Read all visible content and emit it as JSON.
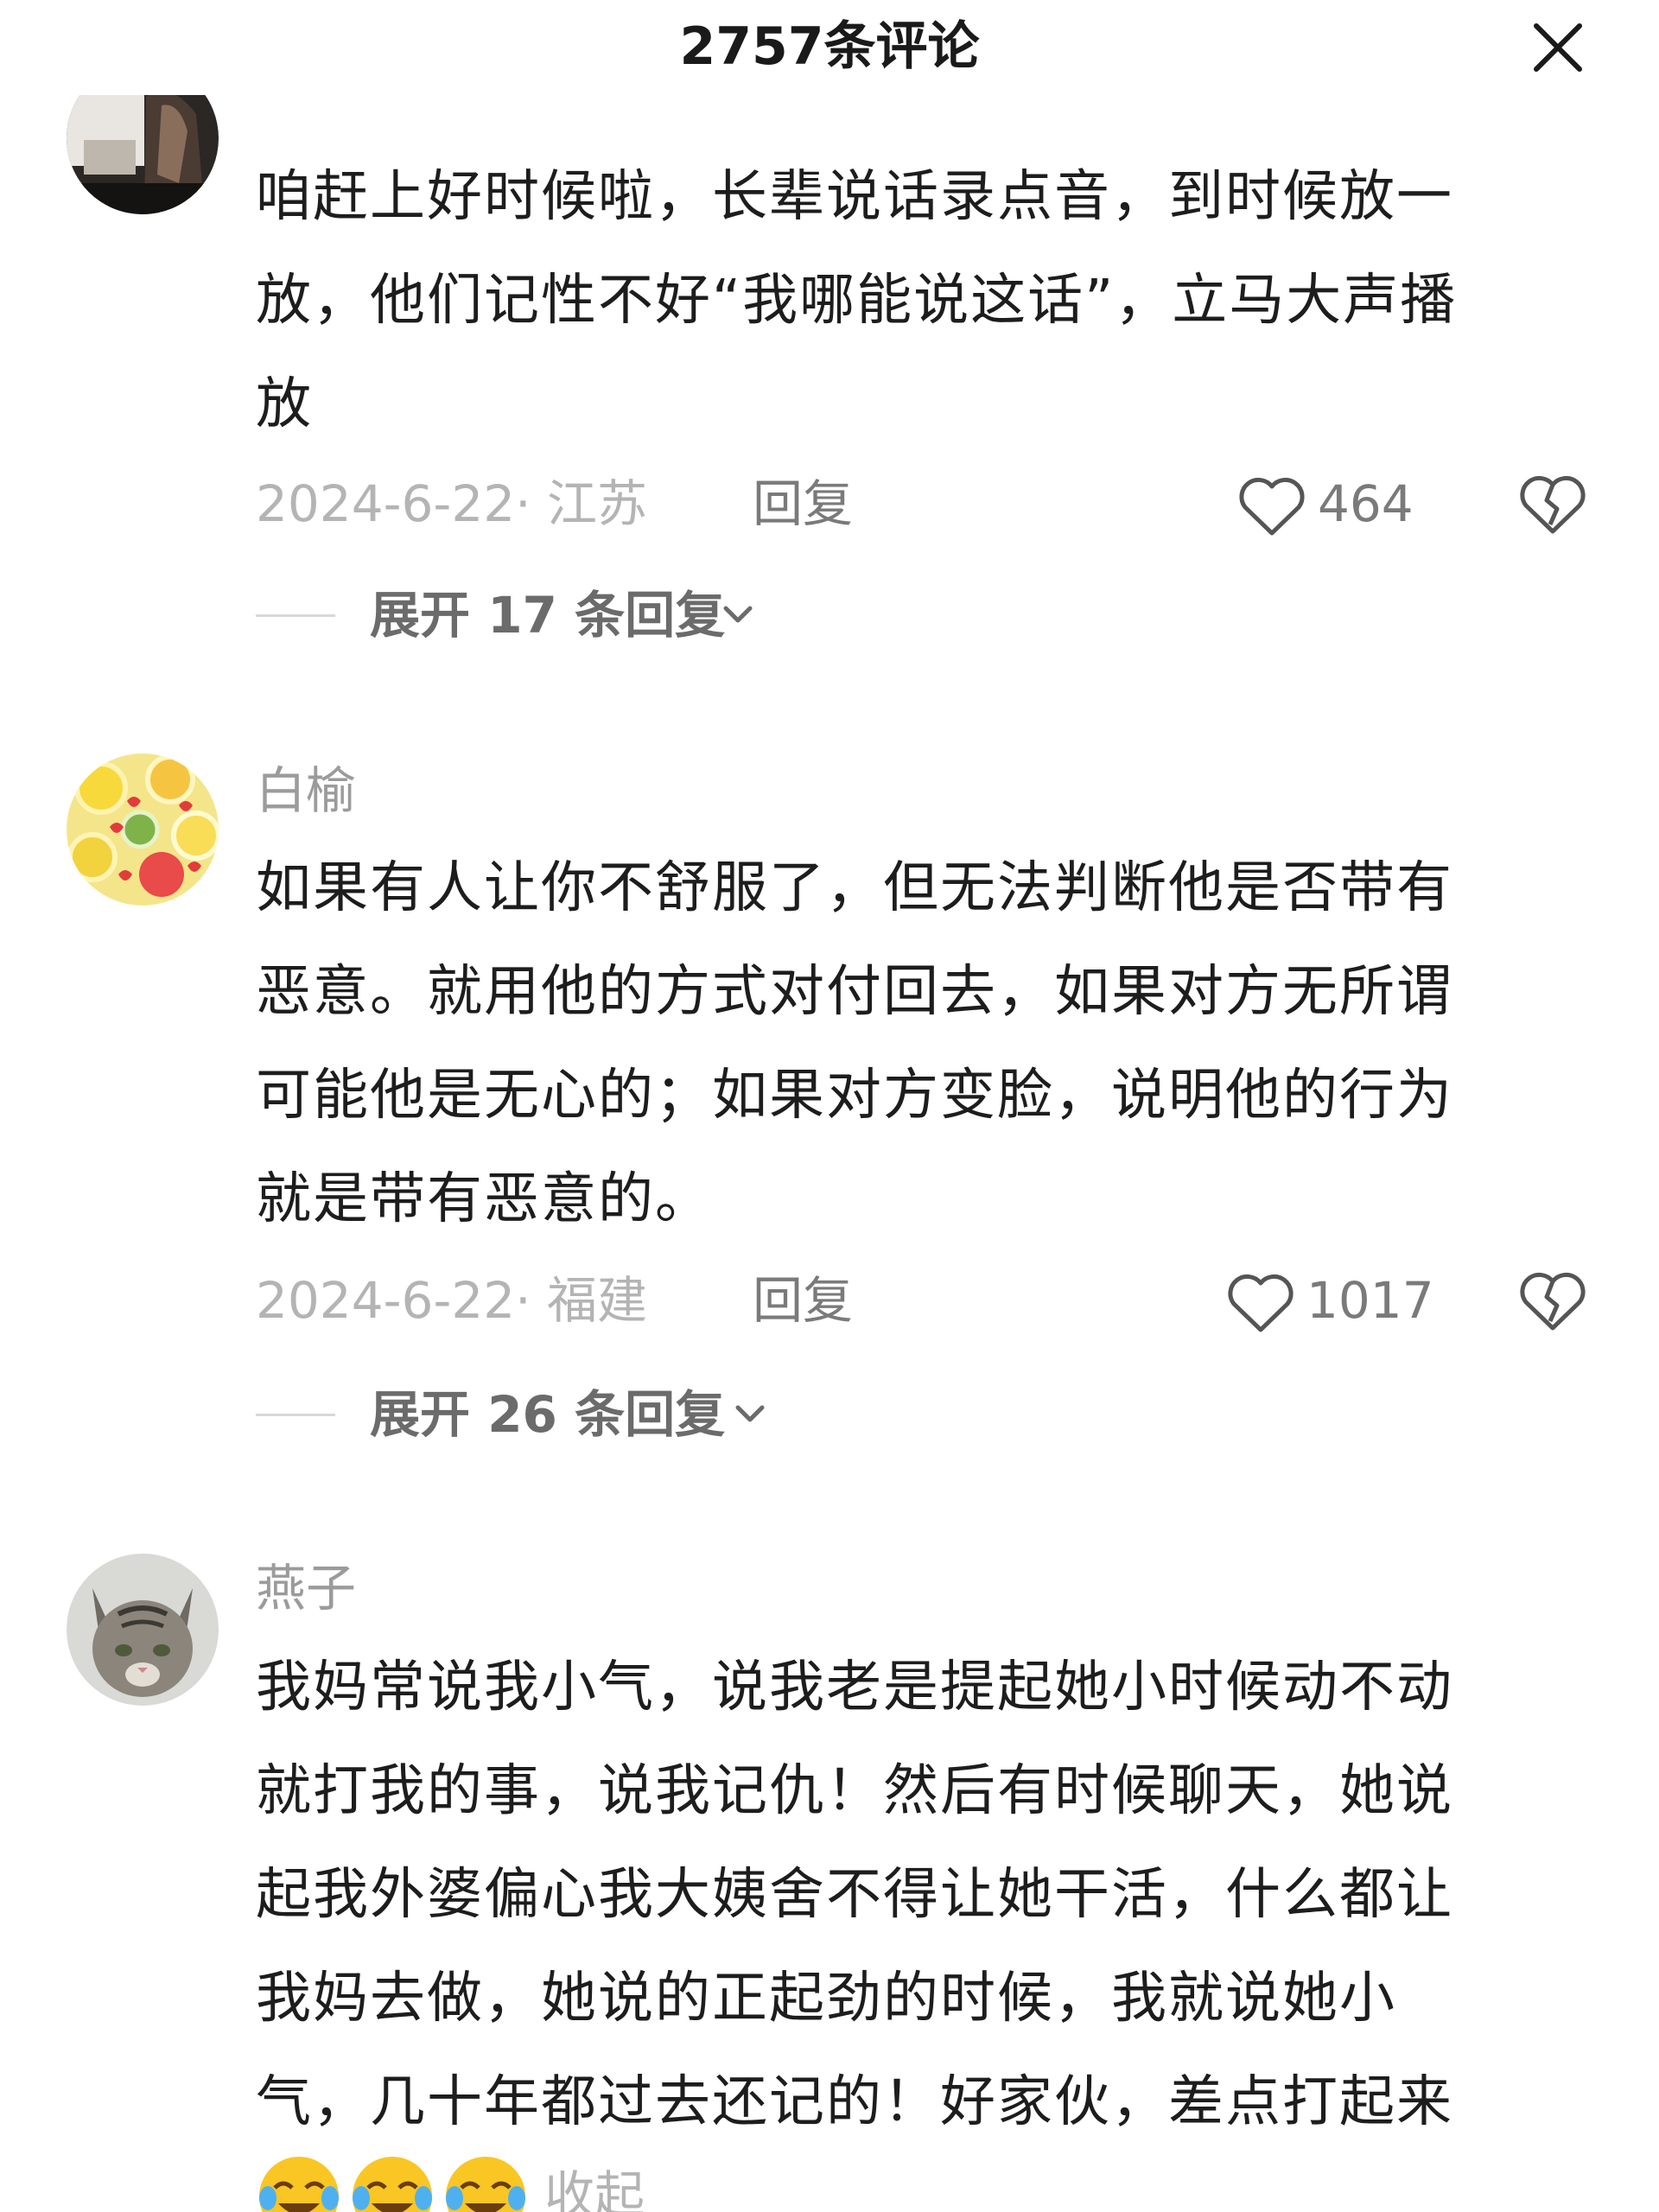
{
  "header": {
    "title": "2757条评论",
    "close_icon": "close-icon"
  },
  "comments": [
    {
      "username": "",
      "lines": [
        "咱赶上好时候啦，长辈说话录点音，到时候放一",
        "放，他们记性不好“我哪能说这话”，立马大声播",
        "放"
      ],
      "date": "2024-6-22· 江苏",
      "reply_label": "回复",
      "likes": "464",
      "expand_label": "展开 17 条回复",
      "avatar_icon": "dark-photo-avatar"
    },
    {
      "username": "白榆",
      "lines": [
        "如果有人让你不舒服了，但无法判断他是否带有",
        "恶意。就用他的方式对付回去，如果对方无所谓",
        "可能他是无心的；如果对方变脸，说明他的行为",
        "就是带有恶意的。"
      ],
      "date": "2024-6-22· 福建",
      "reply_label": "回复",
      "likes": "1017",
      "expand_label": "展开 26 条回复",
      "avatar_icon": "fruit-slices-avatar"
    },
    {
      "username": "燕子",
      "lines": [
        "我妈常说我小气，说我老是提起她小时候动不动",
        "就打我的事，说我记仇！然后有时候聊天，她说",
        "起我外婆偏心我大姨舍不得让她干活，什么都让",
        "我妈去做，她说的正起劲的时候，我就说她小",
        "气，几十年都过去还记的！好家伙，差点打起来"
      ],
      "collapse_label": "收起",
      "avatar_icon": "cat-avatar"
    }
  ],
  "icons": {
    "like": "heart-icon",
    "dislike": "broken-heart-icon",
    "chevron": "chevron-down-icon",
    "emoji": "laughing-crying-emoji"
  },
  "colors": {
    "text": "#1d1d1d",
    "muted": "#9b9b9b",
    "secondary": "#7a7a7a"
  }
}
